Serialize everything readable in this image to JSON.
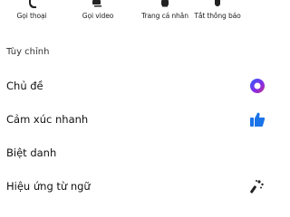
{
  "actions": {
    "call_label": "Gọi thoại",
    "video_label": "Gọi video",
    "profile_label": "Trang cá nhân",
    "mute_label": "Tắt thông báo"
  },
  "customize": {
    "section_title": "Tùy chỉnh",
    "theme_label": "Chủ đề",
    "quick_reaction_label": "Cảm xúc nhanh",
    "nickname_label": "Biệt danh",
    "word_effects_label": "Hiệu ứng từ ngữ"
  },
  "colors": {
    "theme_outer": "#7b2ff7",
    "theme_inner": "#ffffff",
    "like_blue": "#1a73e8",
    "icon_dark": "#222222"
  },
  "icons": {
    "call": "phone-icon",
    "video": "video-camera-icon",
    "profile": "profile-icon",
    "mute": "bell-icon",
    "theme": "theme-circle-icon",
    "quick_reaction": "thumbs-up-icon",
    "word_effects": "sparkle-wand-icon"
  }
}
